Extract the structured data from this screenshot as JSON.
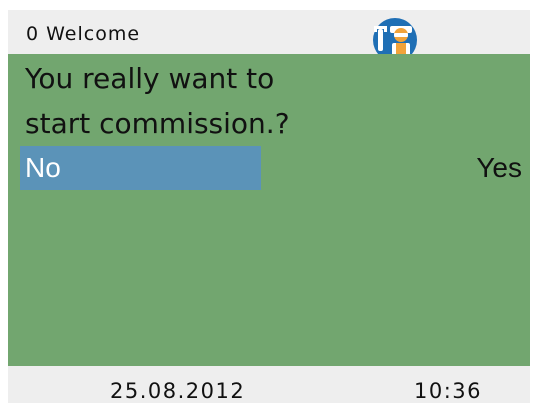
{
  "header": {
    "title": "0 Welcome",
    "icon": "service-technician-icon"
  },
  "dialog": {
    "question_line1": "You really want to",
    "question_line2": "start commission.?",
    "option_no": "No",
    "option_yes": "Yes",
    "selected": "No"
  },
  "footer": {
    "date": "25.08.2012",
    "time": "10:36"
  },
  "colors": {
    "header_bg": "#eeeeee",
    "main_bg": "#72a66f",
    "selection_bg": "#5b93b8",
    "icon_blue": "#1f6fb5",
    "icon_orange": "#f2a33a"
  }
}
